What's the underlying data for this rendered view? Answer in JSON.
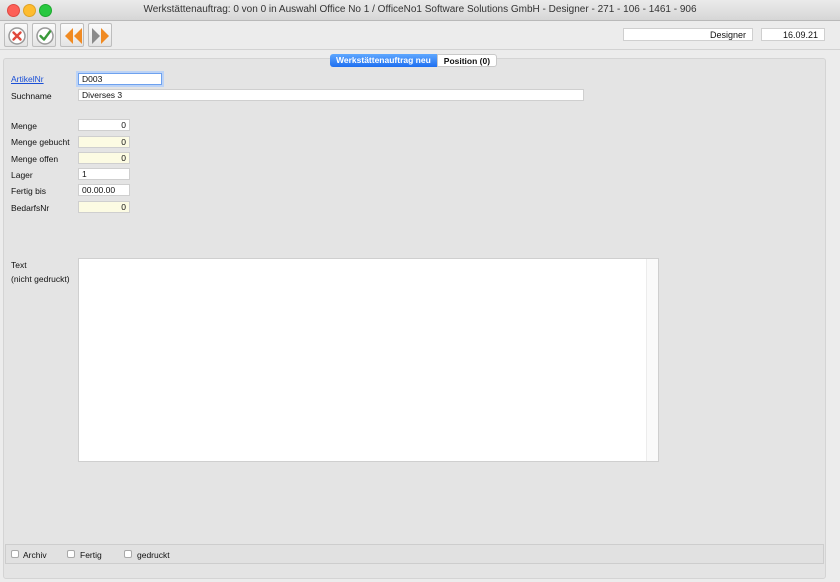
{
  "window": {
    "title": "Werkstättenauftrag: 0 von 0 in Auswahl Office No 1 /  OfficeNo1 Software Solutions GmbH - Designer - 271 - 106 - 1461 - 906"
  },
  "toolbar": {
    "buttons": [
      {
        "name": "cancel",
        "icon": "x-circle-icon",
        "color": "#e0483c"
      },
      {
        "name": "confirm",
        "icon": "check-circle-icon",
        "color": "#3a9a3a"
      },
      {
        "name": "previous",
        "icon": "double-left-arrow-icon",
        "color": "#f08a22"
      },
      {
        "name": "next",
        "icon": "double-right-arrow-icon",
        "color": "#f08a22"
      }
    ],
    "user": "Designer",
    "date": "16.09.21"
  },
  "tabs": [
    {
      "label": "Werkstättenauftrag neu",
      "active": true
    },
    {
      "label": "Position (0)",
      "active": false
    }
  ],
  "form": {
    "artikelnr": {
      "label": "ArtikelNr",
      "value": "D003"
    },
    "suchname": {
      "label": "Suchname",
      "value": "Diverses 3"
    },
    "menge": {
      "label": "Menge",
      "value": "0"
    },
    "menge_gebucht": {
      "label": "Menge gebucht",
      "value": "0"
    },
    "menge_offen": {
      "label": "Menge offen",
      "value": "0"
    },
    "lager": {
      "label": "Lager",
      "value": "1"
    },
    "fertig_bis": {
      "label": "Fertig bis",
      "value": "00.00.00"
    },
    "bedarfsnr": {
      "label": "BedarfsNr",
      "value": "0"
    },
    "text": {
      "label": "Text",
      "sublabel": "(nicht gedruckt)",
      "value": ""
    }
  },
  "checkboxes": [
    {
      "label": "Archiv",
      "checked": false
    },
    {
      "label": "Fertig",
      "checked": false
    },
    {
      "label": "gedruckt",
      "checked": false
    }
  ]
}
